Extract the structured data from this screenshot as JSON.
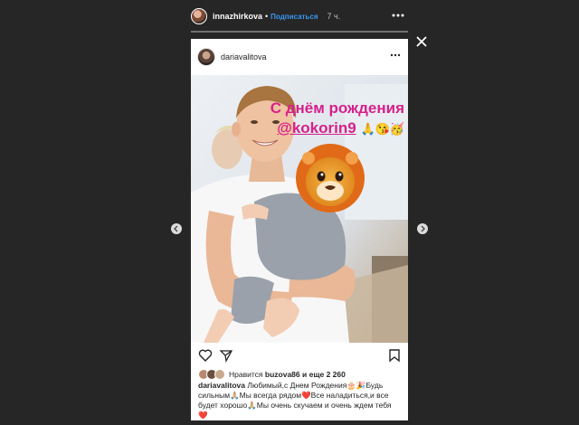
{
  "story": {
    "username": "innazhirkova",
    "dot": "•",
    "follow_label": "Подписаться",
    "time": "7 ч."
  },
  "post": {
    "username": "dariavalitova",
    "overlay_line1": "С днём рождения",
    "overlay_mention": "@kokorin9",
    "overlay_emoji": "🙏😘🥳",
    "likes_prefix": "Нравится",
    "likes_user": "buzova86",
    "likes_suffix": "и еще 2 260",
    "caption_user": "dariavalitova",
    "caption_text": "Любимый,с Днем Рождения🎂🎉Будь сильным🙏🏼Мы всегда рядом❤️Все наладиться,и все будет хорошо🙏🏼Мы очень скучаем и очень ждем тебя ❤️"
  },
  "icons": {
    "close": "close-icon",
    "more": "more-icon",
    "heart": "heart-icon",
    "share": "send-icon",
    "bookmark": "bookmark-icon",
    "prev": "chevron-left-icon",
    "next": "chevron-right-icon"
  },
  "colors": {
    "overlay_text": "#d7208a",
    "follow": "#3897f0",
    "background": "#262626"
  }
}
